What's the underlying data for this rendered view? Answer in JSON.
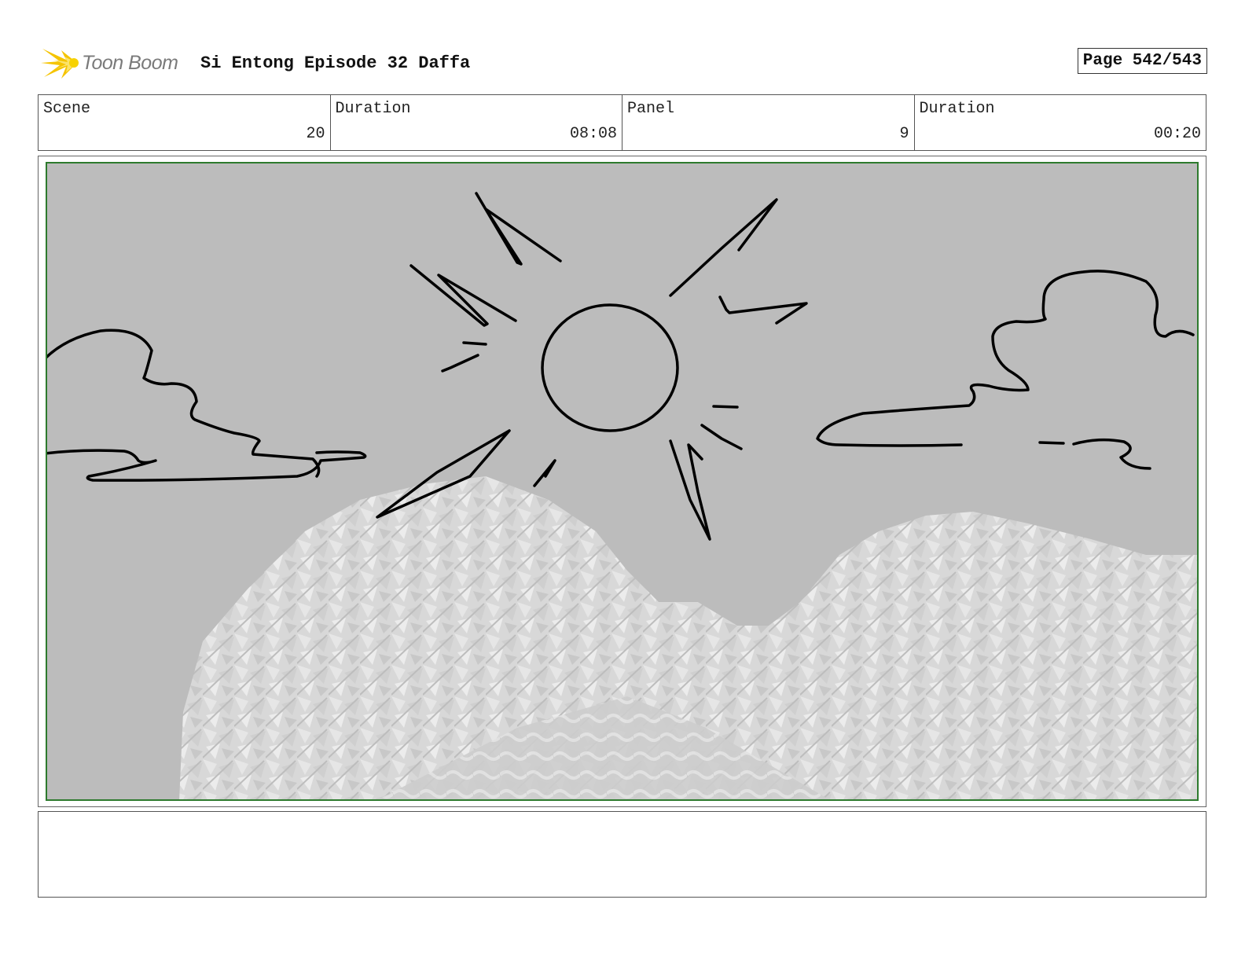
{
  "header": {
    "logo_text": "Toon Boom",
    "title": "Si Entong Episode 32 Daffa",
    "page": "Page 542/543"
  },
  "info": [
    {
      "label": "Scene",
      "value": "20"
    },
    {
      "label": "Duration",
      "value": "08:08"
    },
    {
      "label": "Panel",
      "value": "9"
    },
    {
      "label": "Duration",
      "value": "00:20"
    }
  ],
  "colors": {
    "sky": "#bcbcbc",
    "safe_frame": "#2d7a2d",
    "logo_flare": "#f5c400"
  },
  "icons": {
    "logo": "toon-boom-flare-icon"
  },
  "notes": ""
}
